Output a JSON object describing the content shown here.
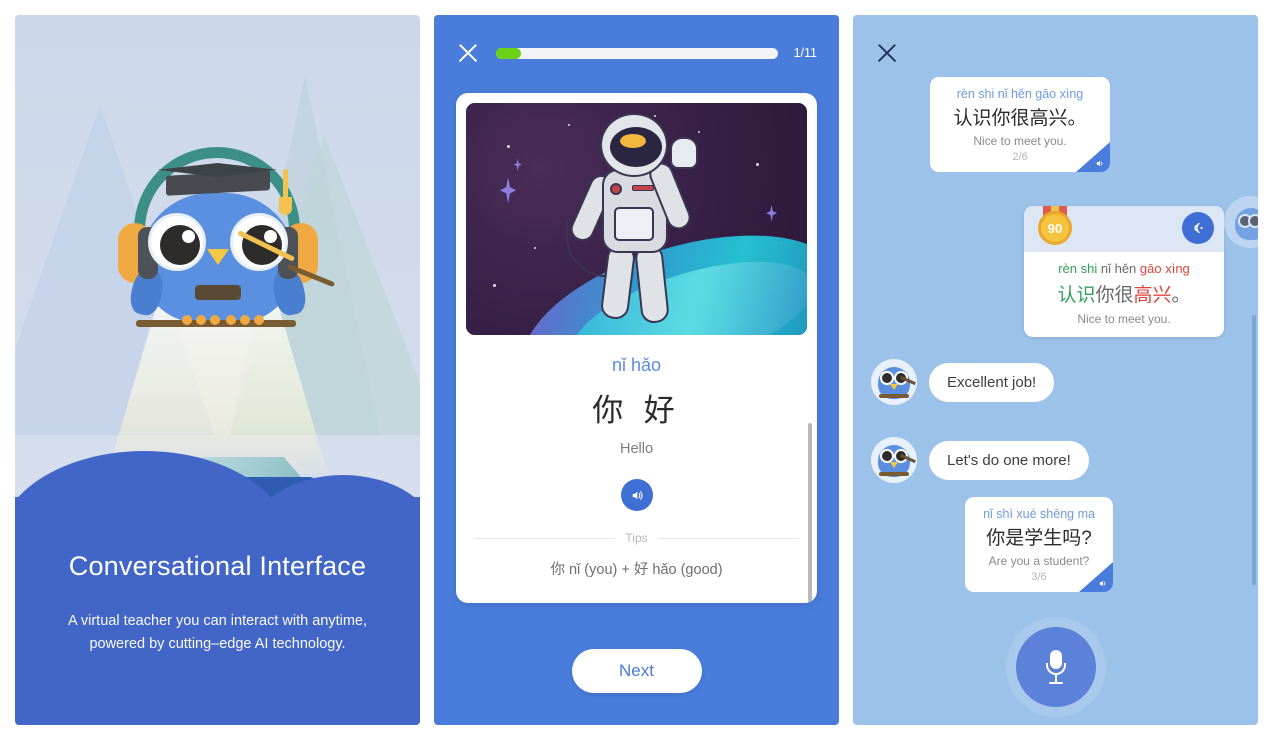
{
  "panel1": {
    "name": "onboarding-slide",
    "title": "Conversational Interface",
    "subtitle_line1": "A virtual teacher you can interact with anytime,",
    "subtitle_line2": "powered by cutting–edge AI technology.",
    "mascot": "owl-teacher-illustration",
    "colors": {
      "background": "#ccd8ea",
      "wave": "#4166c7",
      "wave_back": "#9fb4e0",
      "text": "#ffffff"
    }
  },
  "panel2": {
    "name": "lesson-card-screen",
    "close_icon": "close-icon",
    "progress": {
      "current": 1,
      "total": 11,
      "label": "1/11",
      "percent": 9,
      "fill_color": "#6cd016",
      "track_color": "#f2f4f8"
    },
    "hero_image": "astronaut-in-space-illustration",
    "pinyin": "nǐ hǎo",
    "hanzi": "你 好",
    "translation": "Hello",
    "audio_icon": "speaker-icon",
    "tips_label": "Tips",
    "tips_text": "你 nǐ (you) + 好 hǎo (good)",
    "next_label": "Next",
    "colors": {
      "background": "#4a7cdc",
      "card": "#ffffff",
      "pinyin": "#5b8ae4",
      "next_text": "#4a7cdc"
    }
  },
  "panel3": {
    "name": "chat-practice-screen",
    "close_icon": "close-icon",
    "messages": [
      {
        "type": "prompt",
        "pinyin": "rèn shi nǐ hěn gāo xìng",
        "hanzi": "认识你很高兴。",
        "translation": "Nice to meet you.",
        "counter": "2/6",
        "speaker_icon": "speaker-icon"
      },
      {
        "type": "score",
        "score": "90",
        "medal_icon": "medal-icon",
        "mic_icon": "mic-wave-icon",
        "pinyin_parts": [
          {
            "text": "rèn shi",
            "state": "good"
          },
          {
            "text": "nǐ hěn",
            "state": "neutral"
          },
          {
            "text": "gāo xìng",
            "state": "bad"
          }
        ],
        "hanzi_parts": [
          {
            "text": "认识",
            "state": "good"
          },
          {
            "text": "你很",
            "state": "neutral"
          },
          {
            "text": "高兴",
            "state": "bad"
          },
          {
            "text": "。",
            "state": "neutral"
          }
        ],
        "translation": "Nice to meet you."
      },
      {
        "type": "teacher",
        "avatar": "owl-avatar",
        "text": "Excellent job!"
      },
      {
        "type": "teacher",
        "avatar": "owl-avatar",
        "text": "Let's do one more!"
      },
      {
        "type": "prompt",
        "pinyin": "nǐ shì xué shēng ma",
        "hanzi": "你是学生吗?",
        "translation": "Are you a student?",
        "counter": "3/6",
        "speaker_icon": "speaker-icon"
      }
    ],
    "mic_button": {
      "icon": "microphone-icon",
      "label": "record"
    },
    "colors": {
      "background": "#9dc2ea",
      "bubble": "#ffffff",
      "accent": "#4a7cdc",
      "good": "#35a05a",
      "bad": "#e0453c",
      "medal": "#f5c33e"
    }
  }
}
